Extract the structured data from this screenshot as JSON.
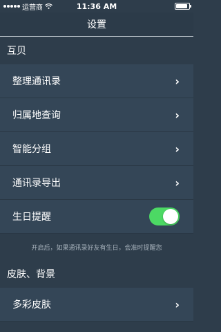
{
  "status_bar": {
    "carrier": "运营商",
    "time": "11:36 AM",
    "battery_level": 0.9
  },
  "navbar": {
    "title": "设置"
  },
  "sections": [
    {
      "header": "互贝",
      "items": [
        {
          "label": "整理通讯录",
          "accessory": "chevron"
        },
        {
          "label": "归属地查询",
          "accessory": "chevron"
        },
        {
          "label": "智能分组",
          "accessory": "chevron"
        },
        {
          "label": "通讯录导出",
          "accessory": "chevron"
        },
        {
          "label": "生日提醒",
          "accessory": "toggle",
          "toggle_on": true
        }
      ],
      "footer": "开启后，如果通讯录好友有生日，会准时提醒您"
    },
    {
      "header": "皮肤、背景",
      "items": [
        {
          "label": "多彩皮肤",
          "accessory": "chevron"
        }
      ]
    }
  ],
  "icons": {
    "chevron": "›",
    "signal": "signal-dots-icon",
    "wifi": "wifi-icon",
    "battery": "battery-icon"
  },
  "colors": {
    "background": "#2e3d4b",
    "cell": "#344657",
    "toggle_on": "#4cd964"
  }
}
